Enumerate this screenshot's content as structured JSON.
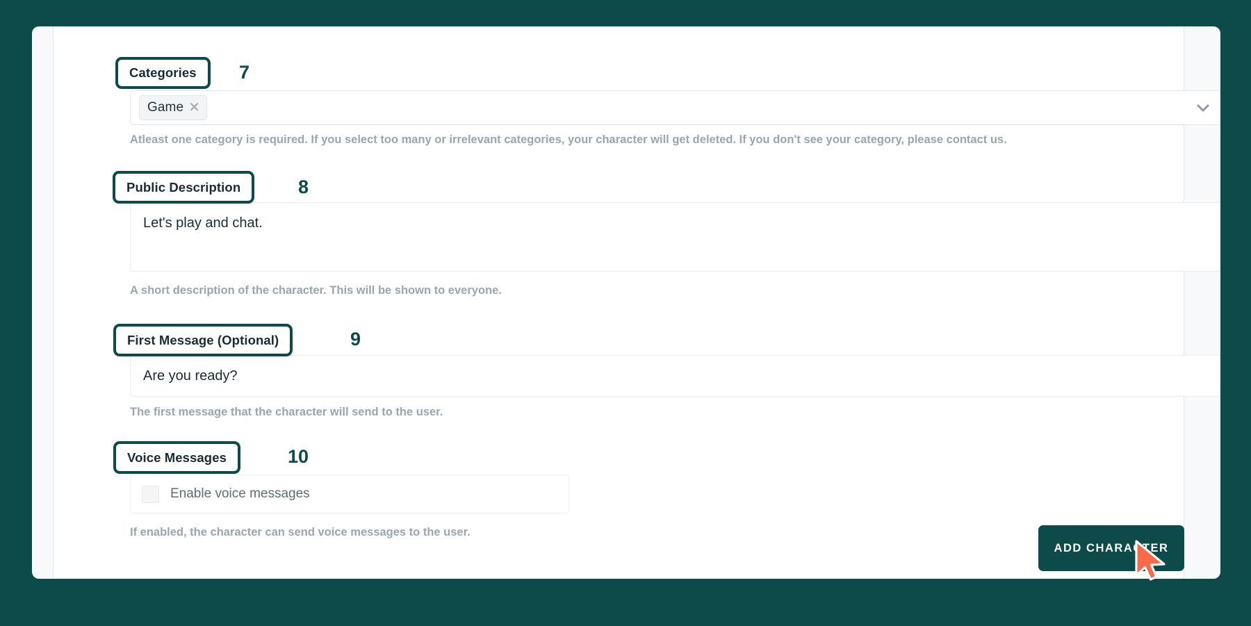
{
  "theme": {
    "page_background": "#0d4b4b",
    "card_background": "#f7f9fa",
    "accent": "#0d4b4b",
    "cursor_color": "#f96a4a",
    "helper_text_color": "#9aa5ac"
  },
  "form": {
    "sections": [
      {
        "id": "categories",
        "label": "Categories",
        "step": "7",
        "type": "multiselect",
        "chips": [
          {
            "label": "Game",
            "remove_icon": "close-icon"
          }
        ],
        "dropdown_icon": "chevron-down-icon",
        "helper": "Atleast one category is required. If you select too many or irrelevant categories, your character will get deleted. If you don't see your category, please contact us."
      },
      {
        "id": "public-description",
        "label": "Public Description",
        "step": "8",
        "type": "textarea",
        "value": "Let's play and chat.",
        "placeholder": "",
        "helper": "A short description of the character. This will be shown to everyone."
      },
      {
        "id": "first-message",
        "label": "First Message (Optional)",
        "step": "9",
        "type": "textarea",
        "value": "Are you ready?",
        "placeholder": "",
        "helper": "The first message that the character will send to the user."
      },
      {
        "id": "voice-messages",
        "label": "Voice Messages",
        "step": "10",
        "type": "checkbox",
        "checkbox_label": "Enable voice messages",
        "checked": false,
        "helper": "If enabled, the character can send voice messages to the user."
      }
    ],
    "submit": {
      "label": "ADD CHARACTER",
      "icon": "cursor-pointer-icon"
    }
  }
}
